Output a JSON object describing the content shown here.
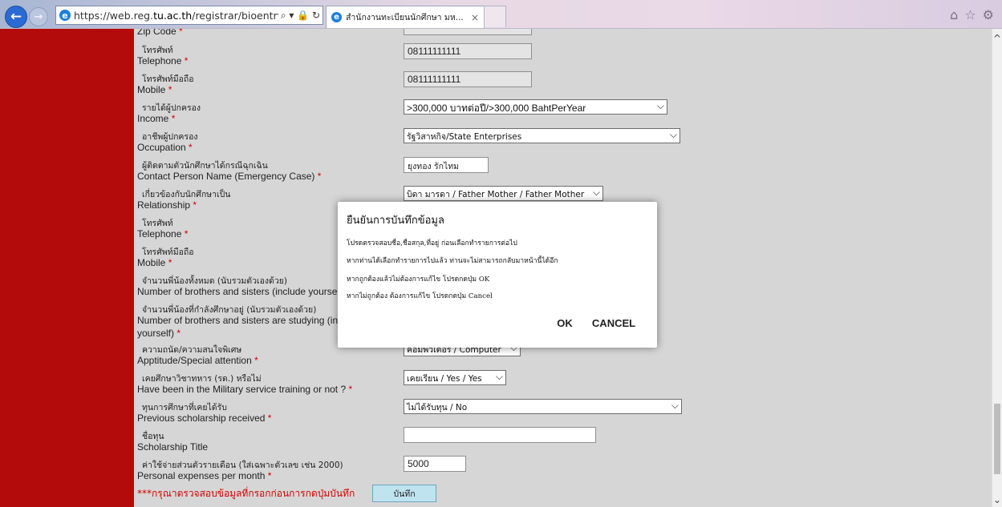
{
  "browser": {
    "back_glyph": "←",
    "forward_glyph": "→",
    "address_prefix": "https://web.reg.",
    "address_domain": "tu.ac.th",
    "address_suffix": "/registrar/bioentryconfigAc",
    "address_controls": "⌕ ▾ 🔒 ↻",
    "tab_title": "สำนักงานทะเบียนนักศึกษา มห...",
    "tab_close": "×",
    "icons": [
      "home-icon",
      "star-icon",
      "gear-icon"
    ]
  },
  "form": {
    "rows": [
      {
        "th": "",
        "en": "Zip Code",
        "required": true
      },
      {
        "th": "โทรศัพท์",
        "en": "Telephone",
        "required": true,
        "value": "08111111111"
      },
      {
        "th": "โทรศัพท์มือถือ",
        "en": "Mobile",
        "required": true,
        "value": "08111111111"
      },
      {
        "th": "รายได้ผู้ปกครอง",
        "en": "Income",
        "required": true,
        "value": ">300,000 บาทต่อปี/>300,000 BahtPerYear"
      },
      {
        "th": "อาชีพผู้ปกครอง",
        "en": "Occupation",
        "required": true,
        "value": "รัฐวิสาหกิจ/State Enterprises"
      },
      {
        "th": "ผู้ติดตามตัวนักศึกษาได้กรณีฉุกเฉิน",
        "en": "Contact Person Name (Emergency Case)",
        "required": true,
        "value": "ยุงทอง รักไทม"
      },
      {
        "th": "เกี่ยวข้องกับนักศึกษาเป็น",
        "en": "Relationship",
        "required": true,
        "value": "บิดา มารดา / Father Mother / Father Mother"
      },
      {
        "th": "โทรศัพท์",
        "en": "Telephone",
        "required": true
      },
      {
        "th": "โทรศัพท์มือถือ",
        "en": "Mobile",
        "required": true
      },
      {
        "th": "จำนวนพี่น้องทั้งหมด (นับรวมตัวเองด้วย)",
        "en": "Number of brothers and sisters (include yourse",
        "required": false
      },
      {
        "th": "จำนวนพี่น้องที่กำลังศึกษาอยู่ (นับรวมตัวเองด้วย)",
        "en": "Number of brothers and sisters are studying (in",
        "en2": "yourself)",
        "required": true
      },
      {
        "th": "ความถนัด/ความสนใจพิเศษ",
        "en": "Apptitude/Special attention",
        "required": true,
        "value": "คอมพิวเตอร์ / Computer"
      },
      {
        "th": "เคยศึกษาวิชาทหาร (รด.) หรือไม่",
        "en": "Have been in the Military service training or not ?",
        "required": true,
        "value": "เคยเรียน / Yes / Yes"
      },
      {
        "th": "ทุนการศึกษาที่เคยได้รับ",
        "en": "Previous scholarship received",
        "required": true,
        "value": "ไม่ได้รับทุน / No"
      },
      {
        "th": "ชื่อทุน",
        "en": "Scholarship Title",
        "required": false,
        "value": ""
      },
      {
        "th": "ค่าใช้จ่ายส่วนตัวรายเดือน (ใส่เฉพาะตัวเลข เช่น 2000)",
        "en": "Personal expenses per month",
        "required": true,
        "value": "5000"
      }
    ],
    "required_mark": "*",
    "footnote": "***กรุณาตรวจสอบข้อมูลที่กรอกก่อนการกดปุ่มบันทึก",
    "save_label": "บันทึก"
  },
  "dialog": {
    "title": "ยืนยันการบันทึกข้อมูล",
    "lines": [
      "โปรดตรวจสอบชื่อ,ชื่อสกุล,ที่อยู่ ก่อนเลือกทำรายการต่อไป",
      "หากท่านได้เลือกทำรายการไปแล้ว ท่านจะไม่สามารถกลับมาหน้านี้ได้อีก",
      "หากถูกต้องแล้วไม่ต้องการแก้ไข โปรดกดปุ่ม OK",
      "หากไม่ถูกต้อง ต้องการแก้ไข โปรดกดปุ่ม Cancel"
    ],
    "ok_label": "OK",
    "cancel_label": "CANCEL"
  },
  "scrollbar": {
    "up_glyph": "^",
    "down_glyph": "⌄"
  }
}
